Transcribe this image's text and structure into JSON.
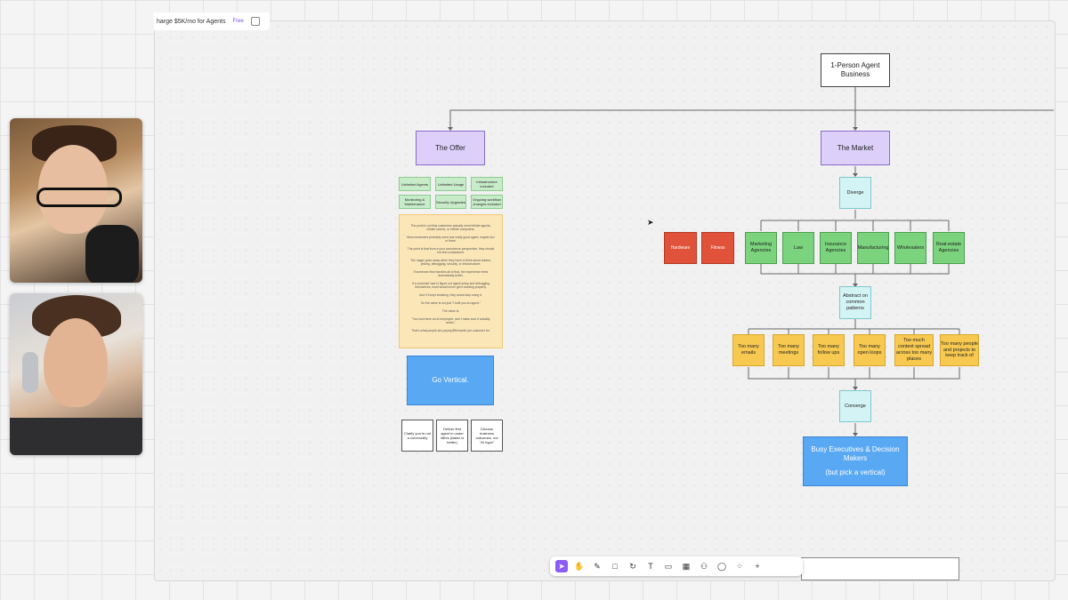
{
  "document": {
    "title": "harge $5K/mo for Agents",
    "plan_badge": "Free"
  },
  "root": {
    "label": "1-Person Agent Business"
  },
  "offer": {
    "title": "The Offer",
    "features": [
      "Unlimited Agents",
      "Unlimited Usage",
      "Infrastructure included",
      "Monitoring & Maintenance",
      "Security Upgrades",
      "Ongoing workflow changes included"
    ],
    "note_lines": [
      "The point is not that customers actually need infinite agents, infinite tokens, or infinite computers.",
      "Most customers probably need one really good agent, maybe two or three.",
      "The point is that from a your conscience perspective, they should not feel constrained.",
      "The magic goes away when they have to think about tokens, pricing, debugging, security, or infrastructure.",
      "If someone else handles all of that, the experience feels dramatically better.",
      "If a customer had to figure out agent setup and debugging themselves, most would never get it working properly.",
      "And if it kept breaking, they would stop using it.",
      "So the value is not just \"I built you an agent.\"",
      "The value is:",
      "\"You now have an AI employee, and I make sure it actually works.\"",
      "That's what people are paying $5k/month per customer for."
    ],
    "go_vertical": "Go Vertical.",
    "cards": [
      "Clarify you're not a commodity",
      "Deliver first agent in under 48hrs (faster is better)",
      "Discuss business outcomes, not \"AI hype\""
    ]
  },
  "market": {
    "title": "The Market",
    "diverge": "Diverge",
    "red_items": [
      "Hardware",
      "Fitness"
    ],
    "verticals": [
      "Marketing Agencies",
      "Law",
      "Insurance Agencies",
      "Manufacturing",
      "Wholesalers",
      "Real-estate Agencies"
    ],
    "abstract": "Abstract on common patterns",
    "patterns": [
      "Too many emails",
      "Too many meetings",
      "Too many follow ups",
      "Too many open loops",
      "Too much context spread across too many places",
      "Too many people and projects to keep track of"
    ],
    "converge": "Converge",
    "target": {
      "line1": "Busy Executives & Decision Makers",
      "line2": "(but pick a vertical)"
    }
  },
  "toolbar": {
    "tools": [
      "select-icon",
      "hand-icon",
      "pen-icon",
      "shape-icon",
      "redo-icon",
      "text-icon",
      "frame-icon",
      "table-icon",
      "person-icon",
      "comment-icon",
      "apps-icon",
      "plus-icon"
    ],
    "glyphs": [
      "➤",
      "✋",
      "✎",
      "□",
      "↻",
      "T",
      "▭",
      "▦",
      "⚇",
      "◯",
      "⁘",
      "+"
    ]
  }
}
